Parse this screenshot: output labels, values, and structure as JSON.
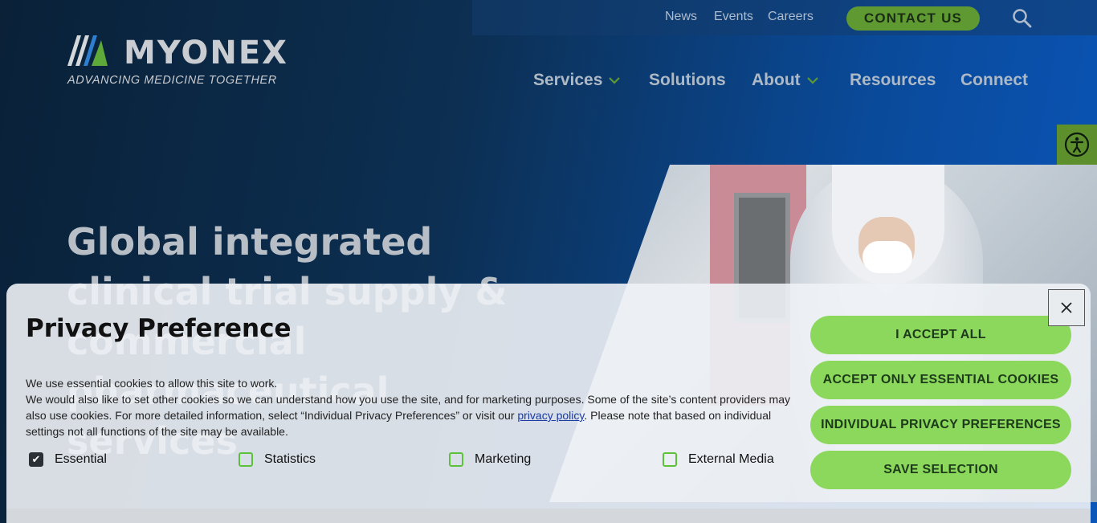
{
  "brand": {
    "name": "MYONEX",
    "tagline": "ADVANCING MEDICINE TOGETHER"
  },
  "utility_nav": {
    "items": [
      "News",
      "Events",
      "Careers"
    ],
    "contact_label": "CONTACT US",
    "search_icon": "search-icon"
  },
  "main_nav": {
    "items": [
      "Services",
      "Solutions",
      "About",
      "Resources",
      "Connect"
    ]
  },
  "accessibility_icon": "accessibility-icon",
  "hero": {
    "headline": "Global integrated clinical trial supply & commercial pharmaceutical services"
  },
  "privacy": {
    "title": "Privacy Preference",
    "line1": "We use essential cookies to allow this site to work.",
    "line2_before": "We would also like to set other cookies so we can understand how you use the site, and for marketing purposes. Some of the site’s content providers may also use cookies. For more detailed information, select “Individual Privacy Preferences” or visit our ",
    "link_text": "privacy policy",
    "line2_after": ". Please note that based on individual settings not all functions of the site may be available.",
    "checkboxes": [
      {
        "label": "Essential",
        "checked": true
      },
      {
        "label": "Statistics",
        "checked": false
      },
      {
        "label": "Marketing",
        "checked": false
      },
      {
        "label": "External Media",
        "checked": false
      }
    ],
    "buttons": {
      "accept_all": "I ACCEPT ALL",
      "accept_essential": "ACCEPT ONLY ESSENTIAL COOKIES",
      "individual": "INDIVIDUAL PRIVACY PREFERENCES",
      "save": "SAVE SELECTION"
    },
    "close_icon": "close-icon"
  },
  "colors": {
    "accent_green": "#5e9a31",
    "button_green": "#8bd85c",
    "navy": "#0a2138",
    "blue": "#0a55b8"
  }
}
